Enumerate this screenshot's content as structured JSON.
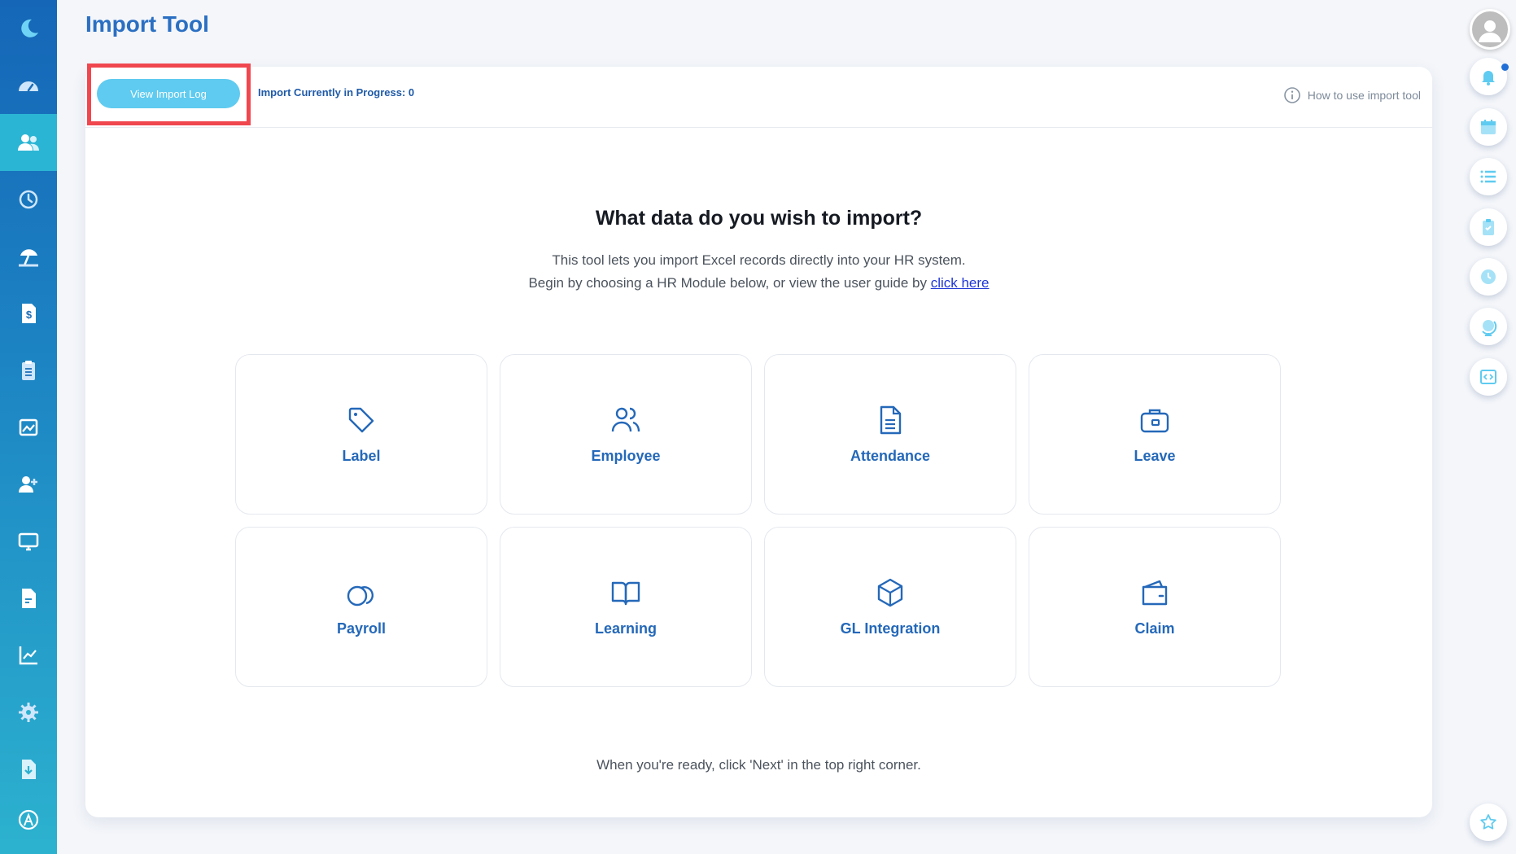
{
  "page": {
    "title": "Import Tool"
  },
  "sidebar": {
    "active_index": 2,
    "items": [
      {
        "icon": "moon-logo-icon"
      },
      {
        "icon": "dashboard-gauge-icon"
      },
      {
        "icon": "people-icon"
      },
      {
        "icon": "history-clock-icon"
      },
      {
        "icon": "beach-umbrella-icon"
      },
      {
        "icon": "dollar-document-icon"
      },
      {
        "icon": "clipboard-icon"
      },
      {
        "icon": "image-chart-icon"
      },
      {
        "icon": "add-person-icon"
      },
      {
        "icon": "monitor-icon"
      },
      {
        "icon": "file-icon"
      },
      {
        "icon": "line-chart-icon"
      },
      {
        "icon": "settings-gear-icon"
      },
      {
        "icon": "download-file-icon"
      },
      {
        "icon": "app-logo-icon"
      }
    ]
  },
  "toolbar": {
    "view_log_label": "View Import Log",
    "progress_text": "Import Currently in Progress: 0",
    "howto_label": "How to use import tool"
  },
  "main": {
    "heading": "What data do you wish to import?",
    "line1": "This tool lets you import Excel records directly into your HR system.",
    "line2_prefix": "Begin by choosing a HR Module below, or view the user guide by ",
    "line2_link": "click here",
    "footer": "When you're ready, click 'Next' in the top right corner."
  },
  "modules": [
    {
      "label": "Label",
      "icon": "tag-icon"
    },
    {
      "label": "Employee",
      "icon": "employees-icon"
    },
    {
      "label": "Attendance",
      "icon": "document-list-icon"
    },
    {
      "label": "Leave",
      "icon": "briefcase-icon"
    },
    {
      "label": "Payroll",
      "icon": "coins-icon"
    },
    {
      "label": "Learning",
      "icon": "book-icon"
    },
    {
      "label": "GL Integration",
      "icon": "cube-icon"
    },
    {
      "label": "Claim",
      "icon": "wallet-icon"
    }
  ],
  "right_rail": [
    {
      "icon": "avatar-icon"
    },
    {
      "icon": "bell-icon"
    },
    {
      "icon": "calendar-icon"
    },
    {
      "icon": "list-icon"
    },
    {
      "icon": "clipboard-check-icon"
    },
    {
      "icon": "clock-icon"
    },
    {
      "icon": "globe-icon"
    },
    {
      "icon": "code-icon"
    },
    {
      "icon": "star-icon"
    }
  ],
  "colors": {
    "accent": "#2a6fc2",
    "button": "#5fcbf0",
    "highlight": "#f0474f",
    "sidebar_top": "#1566b7",
    "sidebar_bottom": "#2cb2cf"
  }
}
